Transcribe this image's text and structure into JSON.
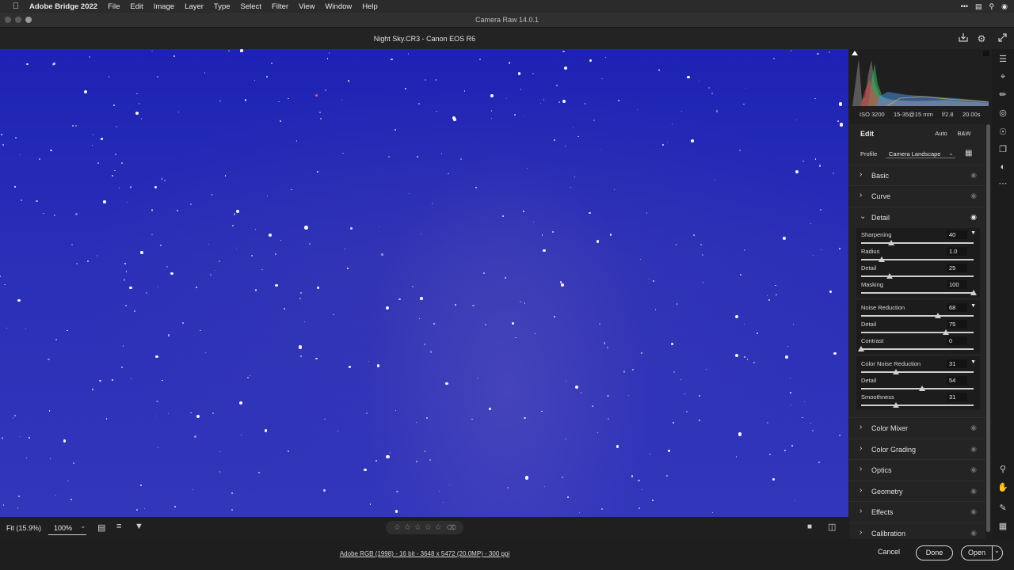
{
  "menubar": {
    "app_name": "Adobe Bridge 2022",
    "menus": [
      "File",
      "Edit",
      "Image",
      "Layer",
      "Type",
      "Select",
      "Filter",
      "View",
      "Window",
      "Help"
    ]
  },
  "window": {
    "title": "Camera Raw 14.0.1"
  },
  "document": {
    "title": "Night Sky.CR3  -  Canon EOS R6"
  },
  "photo_toolbar": {
    "fit_label": "Fit (15.9%)",
    "zoom_value": "100%",
    "zoom_caret": "⌄"
  },
  "rating": {
    "stars": 0
  },
  "exif": {
    "iso": "ISO 3200",
    "lens": "15-35@15 mm",
    "aperture": "f/2.8",
    "shutter": "20.00s"
  },
  "edit_panel": {
    "heading": "Edit",
    "auto_label": "Auto",
    "bw_label": "B&W",
    "profile_label": "Profile",
    "profile_value": "Camera Landscape"
  },
  "sections_top": [
    {
      "label": "Basic"
    },
    {
      "label": "Curve"
    }
  ],
  "detail_section": {
    "label": "Detail"
  },
  "detail_groups": [
    {
      "rows": [
        {
          "name": "Sharpening",
          "value": "40",
          "pos": 0.27,
          "disclosure": true
        },
        {
          "name": "Radius",
          "value": "1.0",
          "pos": 0.18
        },
        {
          "name": "Detail",
          "value": "25",
          "pos": 0.25
        },
        {
          "name": "Masking",
          "value": "100",
          "pos": 1.0
        }
      ]
    },
    {
      "rows": [
        {
          "name": "Noise Reduction",
          "value": "68",
          "pos": 0.68,
          "disclosure": true
        },
        {
          "name": "Detail",
          "value": "75",
          "pos": 0.75
        },
        {
          "name": "Contrast",
          "value": "0",
          "pos": 0.0
        }
      ]
    },
    {
      "rows": [
        {
          "name": "Color Noise Reduction",
          "value": "31",
          "pos": 0.31,
          "disclosure": true
        },
        {
          "name": "Detail",
          "value": "54",
          "pos": 0.54
        },
        {
          "name": "Smoothness",
          "value": "31",
          "pos": 0.31
        }
      ]
    }
  ],
  "sections_bottom": [
    {
      "label": "Color Mixer"
    },
    {
      "label": "Color Grading"
    },
    {
      "label": "Optics"
    },
    {
      "label": "Geometry"
    },
    {
      "label": "Effects"
    },
    {
      "label": "Calibration"
    }
  ],
  "status": {
    "workflow": "Adobe RGB (1998) - 16 bit - 3648 x 5472 (20.0MP) - 300 ppi"
  },
  "buttons": {
    "cancel": "Cancel",
    "done": "Done",
    "open": "Open"
  },
  "colors": {
    "sky": "#2a2fb8",
    "panel": "#242424",
    "accent_red": "#ff5a5a"
  },
  "icons": [
    "apple-icon",
    "save-icon",
    "gear-icon",
    "fullscreen-icon",
    "edit-sliders-icon",
    "crop-icon",
    "healing-icon",
    "masking-icon",
    "red-eye-icon",
    "presets-icon",
    "snapshots-icon",
    "more-icon",
    "zoom-icon",
    "hand-icon",
    "sampler-icon",
    "grid-icon",
    "eye-icon",
    "chevron-right-icon",
    "chevron-down-icon",
    "filter-icon",
    "sort-icon",
    "compare-icon",
    "trash-icon"
  ]
}
